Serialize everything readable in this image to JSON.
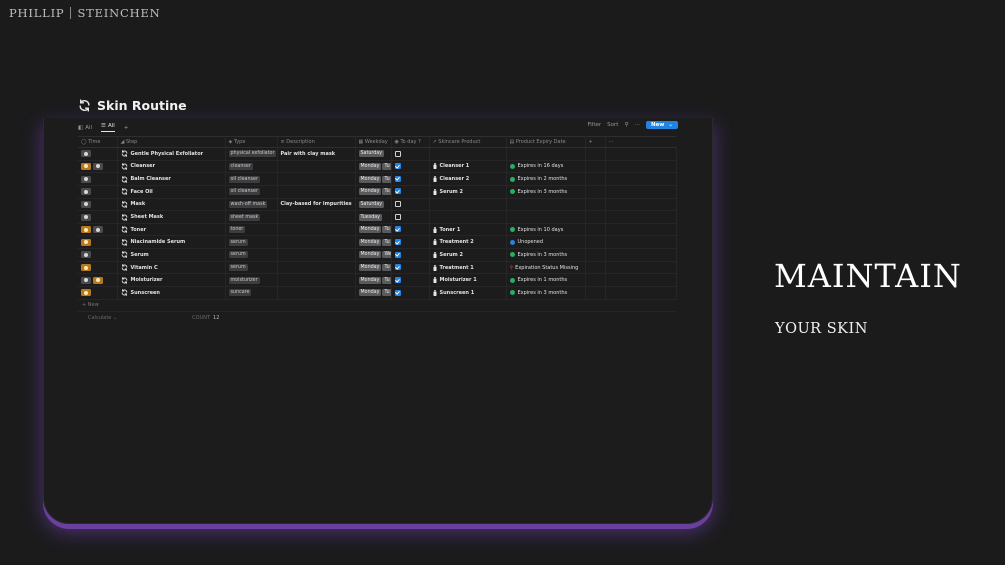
{
  "brand": {
    "first": "PHILLIP",
    "last": "STEINCHEN"
  },
  "database": {
    "title": "Skin Routine",
    "views": [
      {
        "label": "All",
        "icon": "layers-icon"
      },
      {
        "label": "All",
        "icon": "list-icon"
      }
    ],
    "toolbar": {
      "filter": "Filter",
      "sort": "Sort",
      "new": "New"
    },
    "columns": [
      "Time",
      "Step",
      "Type",
      "Description",
      "Weekday",
      "To day ?",
      "Skincare Product",
      "Product Expiry Date"
    ],
    "rows": [
      {
        "time": [
          "pm"
        ],
        "step": "Gentle Physical Exfoliator",
        "type": "physical exfoliator",
        "description": "Pair with clay mask",
        "weekday": [
          "Saturday"
        ],
        "done": false,
        "product": "",
        "expiry": "",
        "expiry_status": ""
      },
      {
        "time": [
          "am",
          "pm"
        ],
        "step": "Cleanser",
        "type": "cleanser",
        "description": "",
        "weekday": [
          "Monday",
          "Tu"
        ],
        "done": true,
        "product": "Cleanser 1",
        "expiry": "Expires in 16 days",
        "expiry_status": "green"
      },
      {
        "time": [
          "pm"
        ],
        "step": "Balm Cleanser",
        "type": "oil cleanser",
        "description": "",
        "weekday": [
          "Monday",
          "Tu"
        ],
        "done": true,
        "product": "Cleanser 2",
        "expiry": "Expires in 2 months",
        "expiry_status": "green"
      },
      {
        "time": [
          "pm"
        ],
        "step": "Face Oil",
        "type": "oil cleanser",
        "description": "",
        "weekday": [
          "Monday",
          "Tu"
        ],
        "done": true,
        "product": "Serum 2",
        "expiry": "Expires in 3 months",
        "expiry_status": "green"
      },
      {
        "time": [
          "pm"
        ],
        "step": "Mask",
        "type": "wash-off mask",
        "description": "Clay-based for impurities",
        "weekday": [
          "Saturday"
        ],
        "done": false,
        "product": "",
        "expiry": "",
        "expiry_status": ""
      },
      {
        "time": [
          "pm"
        ],
        "step": "Sheet Mask",
        "type": "sheet mask",
        "description": "",
        "weekday": [
          "Tuesday"
        ],
        "done": false,
        "product": "",
        "expiry": "",
        "expiry_status": ""
      },
      {
        "time": [
          "am",
          "pm"
        ],
        "step": "Toner",
        "type": "toner",
        "description": "",
        "weekday": [
          "Monday",
          "Tu"
        ],
        "done": true,
        "product": "Toner 1",
        "expiry": "Expires in 10 days",
        "expiry_status": "green"
      },
      {
        "time": [
          "am"
        ],
        "step": "Niacinamide Serum",
        "type": "serum",
        "description": "",
        "weekday": [
          "Monday",
          "Tu"
        ],
        "done": true,
        "product": "Treatment 2",
        "expiry": "Unopened",
        "expiry_status": "blue"
      },
      {
        "time": [
          "pm"
        ],
        "step": "Serum",
        "type": "serum",
        "description": "",
        "weekday": [
          "Monday",
          "We"
        ],
        "done": true,
        "product": "Serum 2",
        "expiry": "Expires in 3 months",
        "expiry_status": "green"
      },
      {
        "time": [
          "am"
        ],
        "step": "Vitamin C",
        "type": "serum",
        "description": "",
        "weekday": [
          "Monday",
          "Tu"
        ],
        "done": true,
        "product": "Treatment 1",
        "expiry": "Expiration Status Missing",
        "expiry_status": "pin"
      },
      {
        "time": [
          "pm",
          "am"
        ],
        "step": "Moisturizer",
        "type": "moisturizer",
        "description": "",
        "weekday": [
          "Monday",
          "Tu"
        ],
        "done": true,
        "product": "Moisturizer 1",
        "expiry": "Expires in 1 months",
        "expiry_status": "green"
      },
      {
        "time": [
          "am"
        ],
        "step": "Sunscreen",
        "type": "suncare",
        "description": "",
        "weekday": [
          "Monday",
          "Tu"
        ],
        "done": true,
        "product": "Sunscreen 1",
        "expiry": "Expires in 3 months",
        "expiry_status": "green"
      }
    ],
    "footer": {
      "new_row": "+ New",
      "calculate": "Calculate",
      "count_label": "COUNT",
      "count_value": "12"
    }
  },
  "hero": {
    "title": "MAINTAIN",
    "subtitle": "YOUR SKIN"
  },
  "colors": {
    "accent": "#2383e2",
    "am": "#b7791f",
    "glow": "#6a3fa0",
    "green": "#27ae60",
    "blue": "#2d7fd8",
    "pin": "#e04a4a"
  }
}
